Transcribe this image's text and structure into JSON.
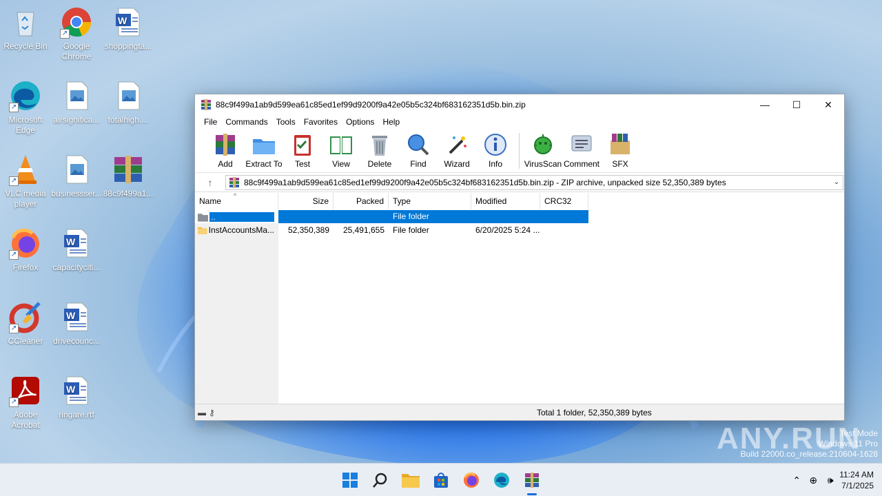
{
  "desktop": {
    "icons": [
      {
        "label": "Recycle Bin",
        "icon": "recycle-bin-icon"
      },
      {
        "label": "Google Chrome",
        "icon": "chrome-icon"
      },
      {
        "label": "shoppingta...",
        "icon": "word-doc-icon"
      },
      {
        "label": "Microsoft Edge",
        "icon": "edge-icon"
      },
      {
        "label": "airsignifica...",
        "icon": "image-file-icon"
      },
      {
        "label": "totalhigh....",
        "icon": "image-file-icon"
      },
      {
        "label": "VLC media player",
        "icon": "vlc-icon"
      },
      {
        "label": "businessser...",
        "icon": "image-file-icon"
      },
      {
        "label": "88c9f499a1...",
        "icon": "winrar-archive-icon"
      },
      {
        "label": "Firefox",
        "icon": "firefox-icon"
      },
      {
        "label": "capacityciti...",
        "icon": "word-doc-icon"
      },
      {
        "label": "CCleaner",
        "icon": "ccleaner-icon"
      },
      {
        "label": "drivecounc...",
        "icon": "word-doc-icon"
      },
      {
        "label": "Adobe Acrobat",
        "icon": "acrobat-icon"
      },
      {
        "label": "ringare.rtf",
        "icon": "word-doc-icon"
      }
    ]
  },
  "window": {
    "title": "88c9f499a1ab9d599ea61c85ed1ef99d9200f9a42e05b5c324bf683162351d5b.bin.zip",
    "controls": {
      "minimize": "—",
      "maximize": "☐",
      "close": "✕"
    },
    "menu": [
      "File",
      "Commands",
      "Tools",
      "Favorites",
      "Options",
      "Help"
    ],
    "toolbar": [
      {
        "label": "Add",
        "icon": "add-archive-icon"
      },
      {
        "label": "Extract To",
        "icon": "extract-folder-icon"
      },
      {
        "label": "Test",
        "icon": "test-clipboard-icon"
      },
      {
        "label": "View",
        "icon": "view-book-icon"
      },
      {
        "label": "Delete",
        "icon": "trash-icon"
      },
      {
        "label": "Find",
        "icon": "magnifier-icon"
      },
      {
        "label": "Wizard",
        "icon": "wand-icon"
      },
      {
        "label": "Info",
        "icon": "info-icon"
      },
      {
        "label": "VirusScan",
        "icon": "virus-scan-icon"
      },
      {
        "label": "Comment",
        "icon": "comment-icon"
      },
      {
        "label": "SFX",
        "icon": "sfx-icon"
      }
    ],
    "address": "88c9f499a1ab9d599ea61c85ed1ef99d9200f9a42e05b5c324bf683162351d5b.bin.zip - ZIP archive, unpacked size 52,350,389 bytes",
    "columns": [
      "Name",
      "Size",
      "Packed",
      "Type",
      "Modified",
      "CRC32"
    ],
    "rows": [
      {
        "name": "..",
        "size": "",
        "packed": "",
        "type": "File folder",
        "modified": "",
        "crc": ""
      },
      {
        "name": "InstAccountsMa...",
        "size": "52,350,389",
        "packed": "25,491,655",
        "type": "File folder",
        "modified": "6/20/2025 5:24 ...",
        "crc": ""
      }
    ],
    "status": "Total 1 folder, 52,350,389 bytes"
  },
  "taskbar": {
    "apps": [
      "start-icon",
      "search-icon",
      "file-explorer-icon",
      "store-icon",
      "firefox-icon",
      "edge-icon",
      "winrar-icon"
    ],
    "time": "11:24 AM",
    "date": "7/1/2025"
  },
  "watermark": {
    "brand": "ANY.RUN",
    "line1": "Test Mode",
    "line2": "Windows 11 Pro",
    "line3": "Build 22000.co_release.210604-1628"
  },
  "colors": {
    "selection": "#0078d7",
    "accent": "#1f5fd8"
  }
}
